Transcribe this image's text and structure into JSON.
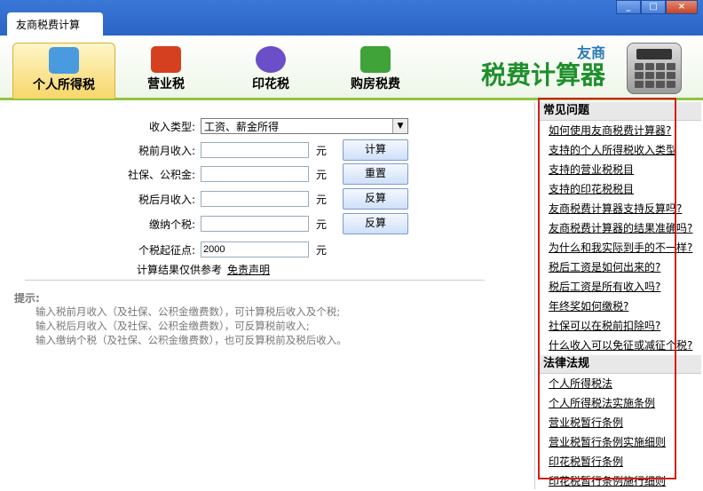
{
  "window": {
    "title": "友商税费计算",
    "buttons": [
      "_",
      "□",
      "×"
    ]
  },
  "nav": {
    "tabs": [
      {
        "label": "个人所得税",
        "active": true,
        "icon": "person-tax-icon",
        "color": "#4a9adf"
      },
      {
        "label": "营业税",
        "active": false,
        "icon": "open-sign-icon",
        "color": "#d44020"
      },
      {
        "label": "印花税",
        "active": false,
        "icon": "stamp-flower-icon",
        "color": "#6a4fc8"
      },
      {
        "label": "购房税费",
        "active": false,
        "icon": "house-icon",
        "color": "#3fa33a"
      }
    ]
  },
  "brand": {
    "sub": "友商",
    "main": "税费计算器"
  },
  "form": {
    "income_type_label": "收入类型:",
    "income_type_value": "工资、薪金所得",
    "pre_tax_label": "税前月收入:",
    "social_label": "社保、公积金:",
    "after_tax_label": "税后月收入:",
    "tax_paid_label": "缴纳个税:",
    "threshold_label": "个税起征点:",
    "threshold_value": "2000",
    "unit": "元",
    "calc_button": "计算",
    "reset_button": "重置",
    "reverse_button_1": "反算",
    "reverse_button_2": "反算",
    "disclaimer_text": "计算结果仅供参考",
    "disclaimer_link": "免责声明"
  },
  "tips": {
    "title": "提示:",
    "lines": [
      "输入税前月收入（及社保、公积金缴费数），可计算税后收入及个税;",
      "输入税后月收入（及社保、公积金缴费数），可反算税前收入;",
      "输入缴纳个税（及社保、公积金缴费数），也可反算税前及税后收入。"
    ]
  },
  "sidebar": {
    "faq_title": "常见问题",
    "faq": [
      "如何使用友商税费计算器?",
      "支持的个人所得税收入类型",
      "支持的营业税税目",
      "支持的印花税税目",
      "友商税费计算器支持反算吗?",
      "友商税费计算器的结果准确吗?",
      "为什么和我实际到手的不一样?",
      "税后工资是如何出来的?",
      "税后工资是所有收入吗?",
      "年终奖如何缴税?",
      "社保可以在税前扣除吗?",
      "什么收入可以免征或减征个税?"
    ],
    "law_title": "法律法规",
    "laws": [
      "个人所得税法",
      "个人所得税法实施条例",
      "营业税暂行条例",
      "营业税暂行条例实施细则",
      "印花税暂行条例",
      "印花税暂行条例施行细则"
    ]
  },
  "highlight_color": "#d21e1e"
}
